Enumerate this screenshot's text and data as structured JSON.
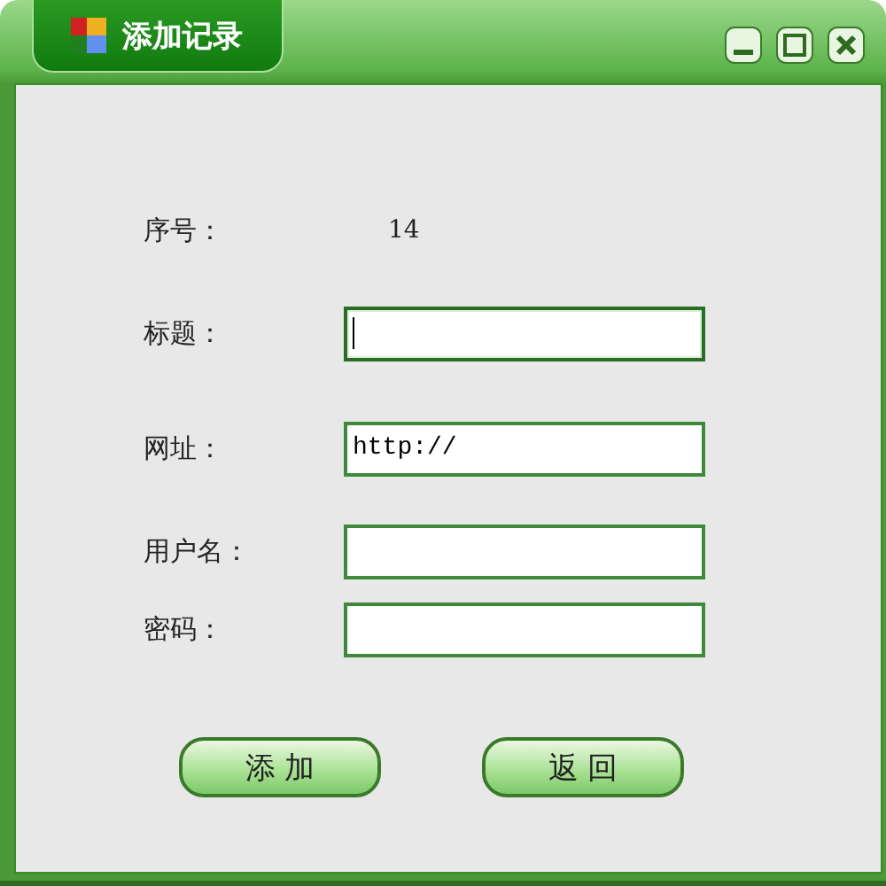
{
  "window": {
    "title": "添加记录"
  },
  "fields": [
    {
      "kind": "text",
      "label": "序号：",
      "value": "14"
    },
    {
      "kind": "input",
      "label": "标题：",
      "focused": true
    },
    {
      "kind": "input",
      "label": "网址：",
      "value": "http://",
      "focused": false
    },
    {
      "kind": "input",
      "label": "用户名：",
      "focused": false
    },
    {
      "kind": "input",
      "label": "密码：",
      "focused": false
    }
  ],
  "buttons": [
    "添 加",
    "返 回"
  ]
}
